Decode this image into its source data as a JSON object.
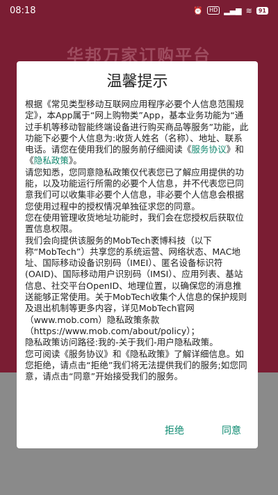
{
  "status": {
    "time": "08:18",
    "battery": "91"
  },
  "background": {
    "title": "华邦万家订购平台"
  },
  "dialog": {
    "title": "温馨提示",
    "p1_a": "根据《常见类型移动互联网应用程序必要个人信息范围规定》，本App属于“网上购物类”App，基本业务功能为“通过手机等移动智能终端设备进行购买商品等服务”功能，此功能下必要个人信息为:收货人姓名（名称）、地址、联系电话。请您在使用我们的服务前仔细阅读《",
    "link_service": "服务协议",
    "p1_b": "》和《",
    "link_privacy": "隐私政策",
    "p1_c": "》。",
    "p2": "请您知悉，您同意隐私政策仅代表您已了解应用提供的功能，以及功能运行所需的必要个人信息，并不代表您已同意我们可以收集非必要个人信息，非必要个人信息会根据您使用过程中的授权情况单独征求您的同意。",
    "p3": "您在使用管理收货地址功能时，我们会在您授权后获取位置信息权限。",
    "p4": "我们会向提供该服务的MobTech袤博科技（以下称“MobTech”）共享您的系统运营、网络状态、MAC地址、国际移动设备识别码（IMEI）、匿名设备标识符(OAID)、国际移动用户识别码（IMSI）、应用列表、基站信息、社交平台OpenID、地理位置，以确保您的消息推送能够正常使用。关于MobTech收集个人信息的保护规则及退出机制等更多内容，详见MobTech官网（www.mob.com）隐私政策条款（https://www.mob.com/about/policy）；",
    "p5": "隐私政策访问路径:我的-关于我们-用户隐私政策。",
    "p6": "您可阅读《服务协议》和《隐私政策》了解详细信息。如您拒绝，请点击“拒绝”我们将无法提供我们的服务;如您同意，请点击“同意”开始接受我们的服务。",
    "reject_label": "拒绝",
    "agree_label": "同意"
  }
}
